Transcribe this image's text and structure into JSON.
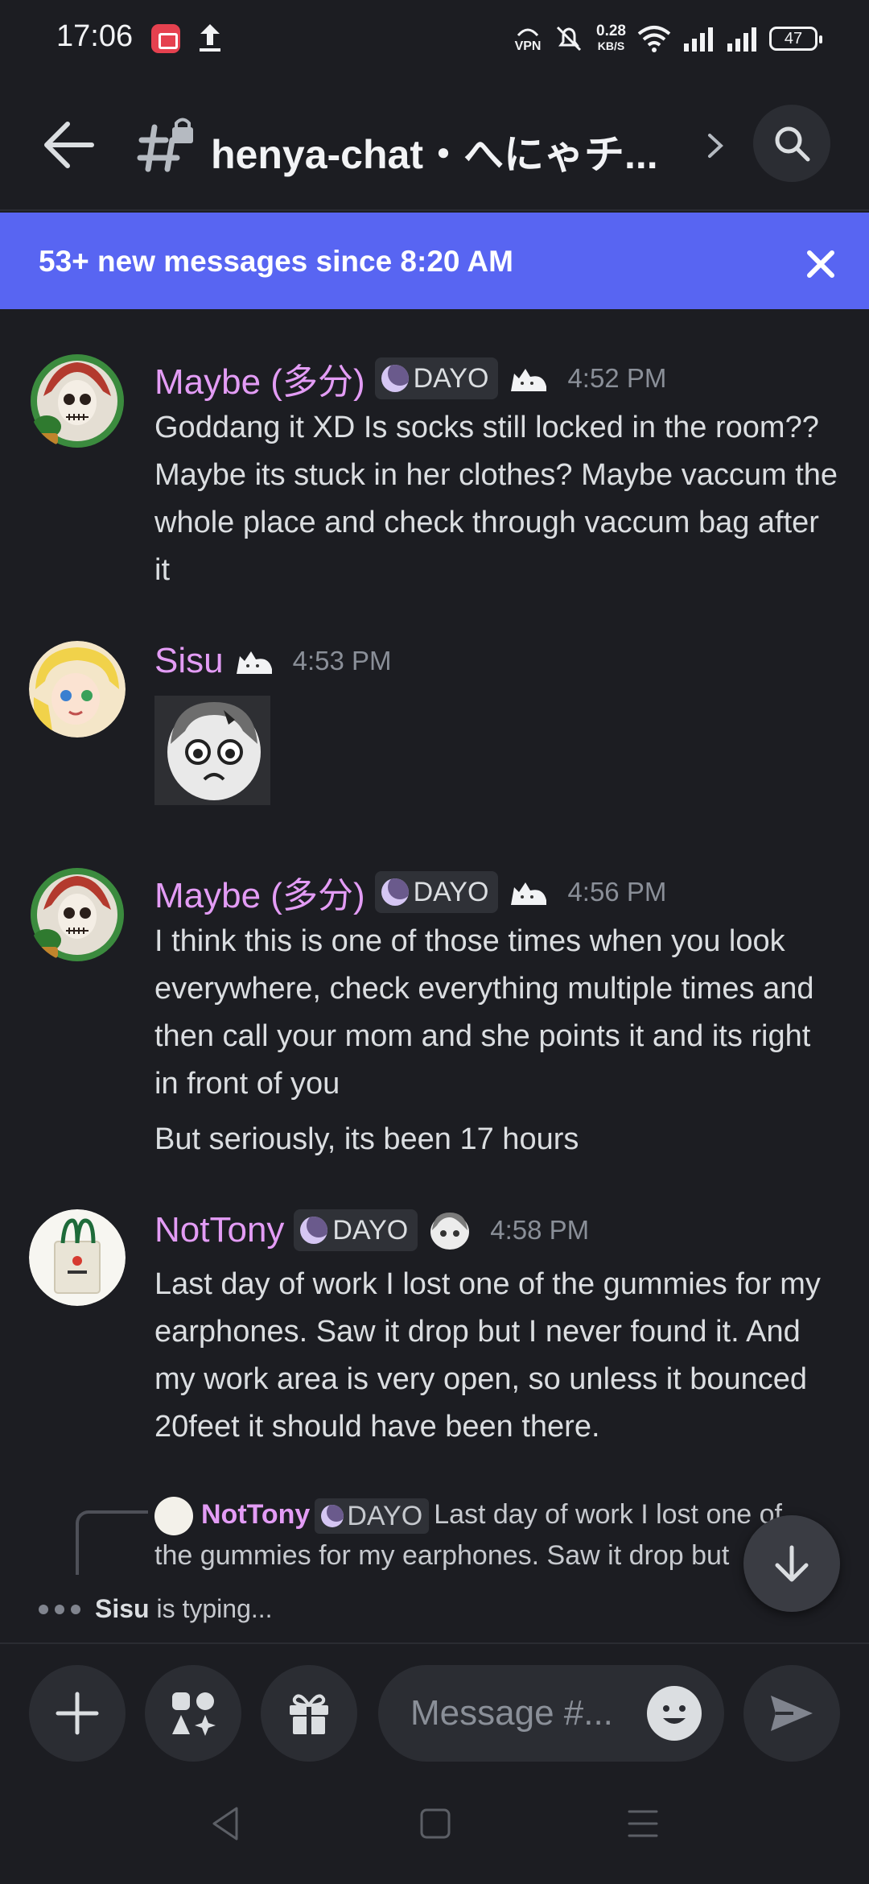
{
  "status": {
    "time": "17:06",
    "vpn": "VPN",
    "speed_value": "0.28",
    "speed_unit": "KB/S",
    "battery": "47"
  },
  "header": {
    "channel_name": "henya-chat・へにゃチ...",
    "search_icon": "search-icon"
  },
  "banner": {
    "text": "53+ new messages since 8:20 AM"
  },
  "messages": [
    {
      "username": "Maybe (多分)",
      "role": "DAYO",
      "time": "4:52 PM",
      "text": "Goddang it XD Is socks still locked in the room?? Maybe its stuck in her clothes? Maybe vaccum the whole place and check through vaccum bag after it"
    },
    {
      "username": "Sisu",
      "time": "4:53 PM"
    },
    {
      "username": "Maybe (多分)",
      "role": "DAYO",
      "time": "4:56 PM",
      "text": "I think this is one of those times when you look everywhere, check everything multiple times and then call your mom and she points it and its right in front of you",
      "text2": "But seriously, its been 17 hours"
    },
    {
      "username": "NotTony",
      "role": "DAYO",
      "time": "4:58 PM",
      "text": "Last day of work I lost one of the gummies for my earphones. Saw it drop but I never found it. And my work area is very open, so unless it bounced 20feet it should have been there."
    }
  ],
  "reply": {
    "username": "NotTony",
    "role": "DAYO",
    "text": "Last day of work I lost one of the gummies for my earphones. Saw it drop but"
  },
  "typing": {
    "user": "Sisu",
    "suffix": "is typing..."
  },
  "composer": {
    "placeholder": "Message #..."
  },
  "colors": {
    "accent": "#5865f2",
    "username": "#e39cf5",
    "background": "#1c1d22"
  }
}
